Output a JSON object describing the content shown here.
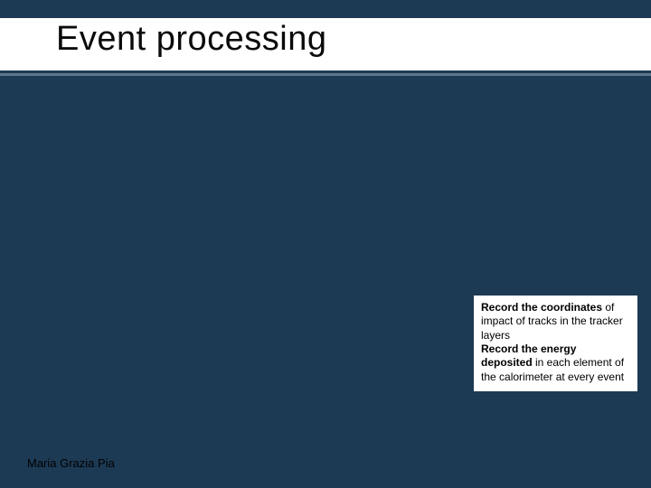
{
  "slide": {
    "title": "Event processing",
    "note": {
      "line1_bold": "Record the coordinates",
      "line1_rest": " of impact of tracks in the tracker layers",
      "line2_bold": "Record the energy deposited",
      "line2_rest": " in each element of the calorimeter at every event"
    },
    "footer_author": "Maria Grazia Pia"
  }
}
